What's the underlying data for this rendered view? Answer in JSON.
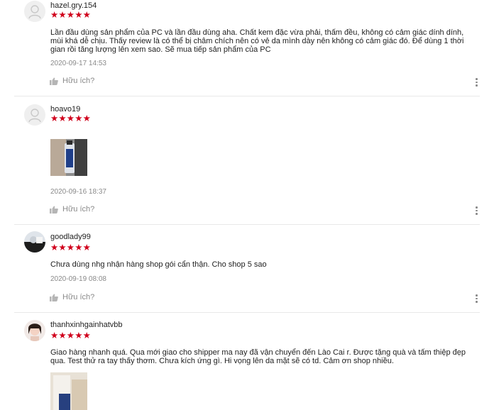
{
  "reviews": [
    {
      "username": "hazel.gry.154",
      "stars": "★★★★★",
      "comment": "Lần đầu dùng sản phẩm của PC và lần đầu dùng aha. Chất kem đặc vừa phải, thấm đều, không có cảm giác dính dính, mùi khá dễ chịu. Thấy review là có thể bị châm chích nên có vẻ da mình dày nên không có cảm giác đó. Để dùng 1 thời gian rồi tăng lượng lên xem sao. Sẽ mua tiếp sản phẩm của PC",
      "date": "2020-09-17 14:53",
      "helpful": "Hữu ích?"
    },
    {
      "username": "hoavo19",
      "stars": "★★★★★",
      "comment": "",
      "date": "2020-09-16 18:37",
      "helpful": "Hữu ích?"
    },
    {
      "username": "goodlady99",
      "stars": "★★★★★",
      "comment": "Chưa dùng nhg nhận hàng shop gói cẩn thận. Cho shop 5 sao",
      "date": "2020-09-19 08:08",
      "helpful": "Hữu ích?"
    },
    {
      "username": "thanhxinhgainhatvbb",
      "stars": "★★★★★",
      "comment": "Giao hàng nhanh quá. Qua mới giao cho shipper ma nay đã vận chuyển đến Lào Cai r. Được tặng quà và tấm thiệp đẹp qua. Test thử ra tay thấy thơm. Chưa kích ứng gì. Hi vọng lên da mặt sẽ có td. Cảm ơn shop nhiều.",
      "date": "",
      "helpful": ""
    }
  ],
  "colors": {
    "star": "#d0011b",
    "muted": "#8a8a8a",
    "divider": "#e8e8e8"
  },
  "icons": {
    "helpful": "thumbs-up-icon",
    "more": "more-vertical-icon",
    "default_avatar": "user-icon"
  }
}
